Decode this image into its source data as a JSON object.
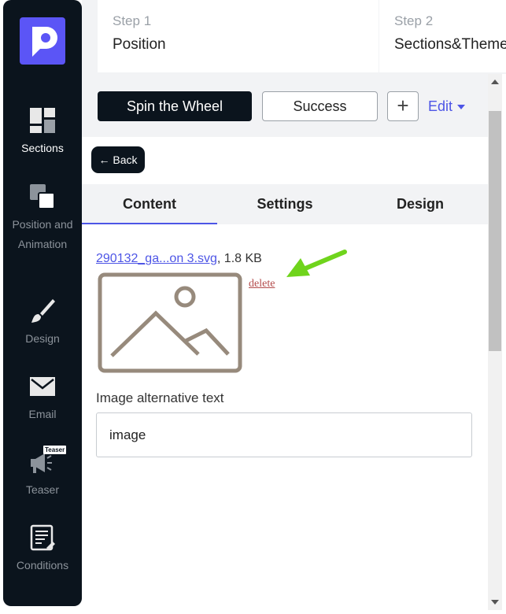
{
  "sidebar": {
    "items": [
      {
        "label": "Sections",
        "icon": "sections-icon"
      },
      {
        "label": "Position and Animation",
        "icon": "layers-icon"
      },
      {
        "label": "Design",
        "icon": "brush-icon"
      },
      {
        "label": "Email",
        "icon": "envelope-icon"
      },
      {
        "label": "Teaser",
        "icon": "megaphone-icon",
        "badge": "Teaser"
      },
      {
        "label": "Conditions",
        "icon": "checklist-icon"
      }
    ]
  },
  "steps": [
    {
      "num": "Step 1",
      "name": "Position"
    },
    {
      "num": "Step 2",
      "name": "Sections&Themes"
    }
  ],
  "toolbar": {
    "section_primary": "Spin the Wheel",
    "section_secondary": "Success",
    "add_symbol": "+",
    "edit_label": "Edit"
  },
  "back_label": "← Back",
  "tabs": [
    "Content",
    "Settings",
    "Design"
  ],
  "file": {
    "name": "290132_ga...on 3.svg",
    "size": ", 1.8 KB",
    "delete_label": "delete"
  },
  "alt_text": {
    "label": "Image alternative text",
    "value": "image"
  },
  "colors": {
    "sidebar_bg": "#0b141d",
    "accent": "#4d55e6",
    "logo": "#5b55f6",
    "delete": "#b34b4b",
    "arrow": "#6fd41c"
  }
}
